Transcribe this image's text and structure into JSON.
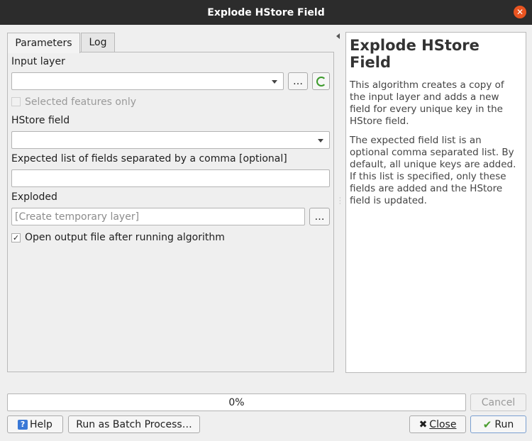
{
  "window": {
    "title": "Explode HStore Field"
  },
  "tabs": [
    {
      "label": "Parameters"
    },
    {
      "label": "Log"
    }
  ],
  "params": {
    "input_layer_label": "Input layer",
    "input_layer_value": "",
    "browse_label": "…",
    "selected_only_label": "Selected features only",
    "hstore_field_label": "HStore field",
    "hstore_field_value": "",
    "expected_list_label": "Expected list of fields separated by a comma [optional]",
    "expected_list_value": "",
    "exploded_label": "Exploded",
    "exploded_placeholder": "[Create temporary layer]",
    "open_output_label": "Open output file after running algorithm",
    "open_output_checked": true
  },
  "help": {
    "title": "Explode HStore Field",
    "p1": "This algorithm creates a copy of the input layer and adds a new field for every unique key in the HStore field.",
    "p2": "The expected field list is an optional comma separated list. By default, all unique keys are added. If this list is specified, only these fields are added and the HStore field is updated."
  },
  "footer": {
    "progress_text": "0%",
    "progress_value": 0,
    "cancel_label": "Cancel",
    "help_label": "Help",
    "batch_label": "Run as Batch Process…",
    "close_label": "Close",
    "run_label": "Run"
  },
  "colors": {
    "titlebar": "#2c2c2c",
    "close_button": "#e95420",
    "help_icon": "#3a78d6",
    "run_check": "#4a9d2f"
  }
}
